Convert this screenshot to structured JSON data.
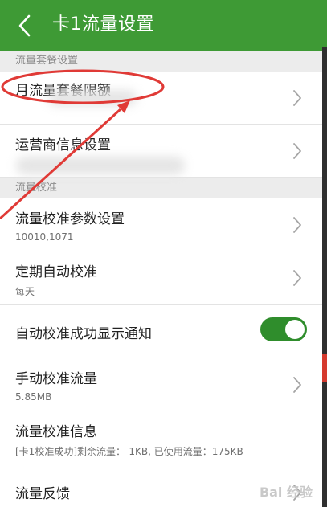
{
  "header": {
    "title": "卡1流量设置"
  },
  "sections": {
    "plan": "流量套餐设置",
    "calibration": "流量校准"
  },
  "rows": {
    "monthly_limit": {
      "label": "月流量套餐限额"
    },
    "carrier_info": {
      "label": "运营商信息设置"
    },
    "calib_params": {
      "label": "流量校准参数设置",
      "value": "10010,1071"
    },
    "auto_calib": {
      "label": "定期自动校准",
      "value": "每天"
    },
    "notify": {
      "label": "自动校准成功显示通知",
      "enabled": true
    },
    "manual": {
      "label": "手动校准流量",
      "value": "5.85MB"
    },
    "calib_info": {
      "label": "流量校准信息",
      "value": "[卡1校准成功]剩余流量：-1KB, 已使用流量：175KB"
    },
    "feedback": {
      "label": "流量反馈"
    }
  },
  "watermark": "Bai 经验",
  "colors": {
    "accent": "#3e9a35",
    "toggle_on": "#2f8d2c",
    "annotation": "#e03a36"
  },
  "icons": {
    "back": "chevron-left-icon",
    "row_arrow": "chevron-right-icon"
  }
}
